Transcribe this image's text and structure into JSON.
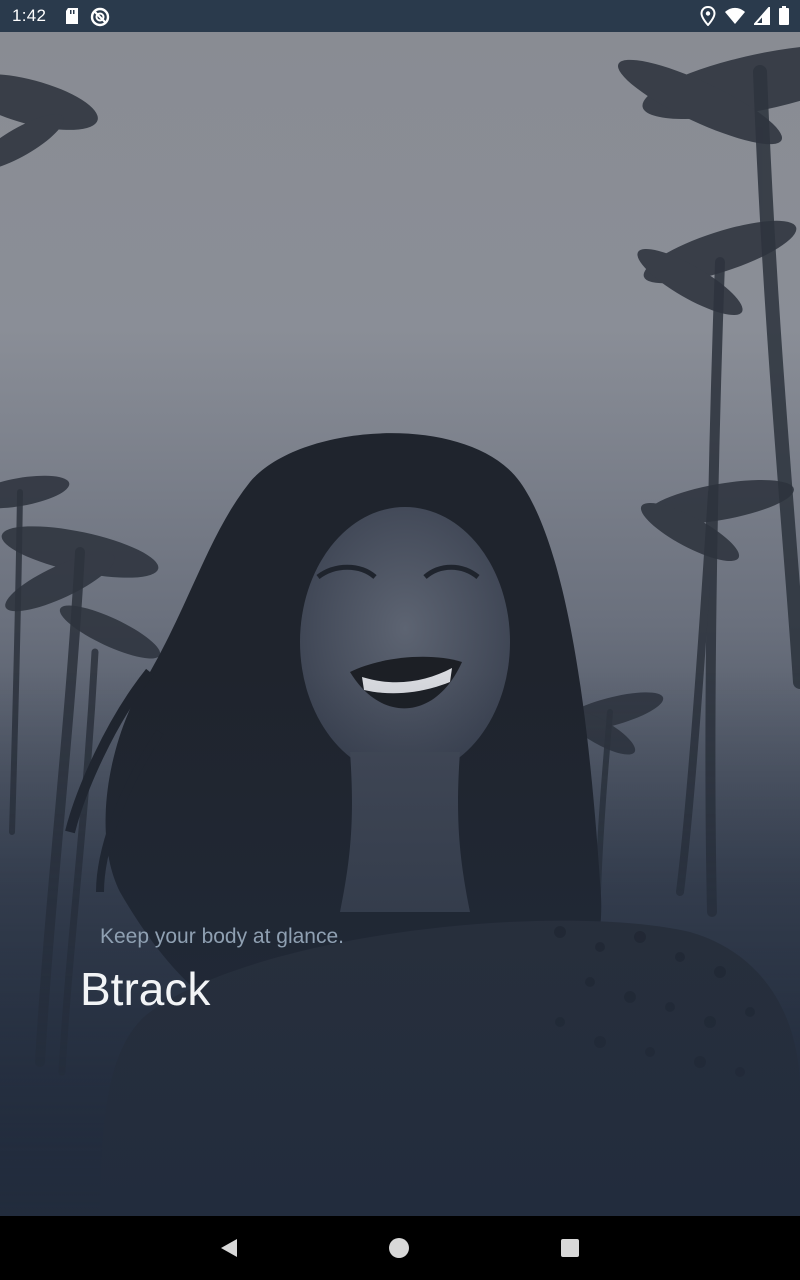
{
  "status_bar": {
    "time": "1:42",
    "left_icons": [
      "sd-card-icon",
      "do-not-disturb-icon"
    ],
    "right_icons": [
      "location-icon",
      "wifi-icon",
      "cellular-signal-icon",
      "battery-icon"
    ]
  },
  "splash": {
    "tagline": "Keep your body at glance.",
    "app_name": "Btrack"
  },
  "nav_bar": {
    "buttons": [
      "back-icon",
      "home-icon",
      "recents-icon"
    ]
  },
  "colors": {
    "background": "#222c3d",
    "status_bar": "#2a3a4c",
    "tagline": "#8fa0b2",
    "title": "#f2f4f6"
  }
}
